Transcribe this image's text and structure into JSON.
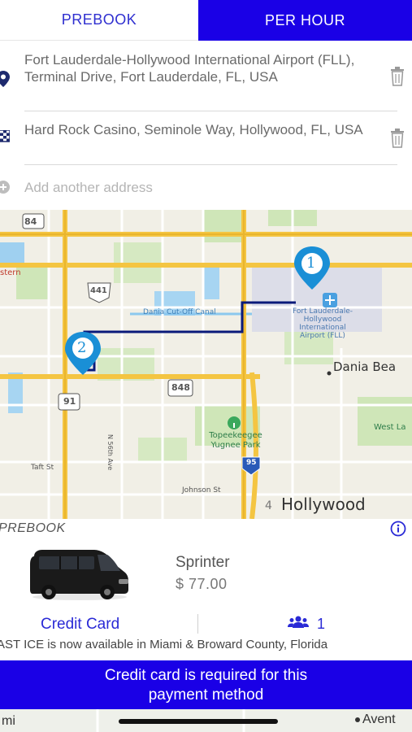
{
  "tabs": {
    "prebook": "PREBOOK",
    "per_hour": "PER HOUR"
  },
  "addresses": {
    "pickup": "Fort Lauderdale-Hollywood International Airport (FLL), Terminal Drive, Fort Lauderdale, FL, USA",
    "dropoff": "Hard Rock Casino, Seminole Way, Hollywood, FL, USA",
    "add_placeholder": "Add another address"
  },
  "map": {
    "marker_1": "1",
    "marker_2": "2",
    "labels": {
      "hwy_84": "84",
      "hwy_441": "441",
      "hwy_848": "848",
      "hwy_91": "91",
      "hwy_95": "95",
      "western": "stern",
      "canal": "Dania Cut-Off Canal",
      "airport": "Fort Lauderdale-Hollywood International Airport (FLL)",
      "dania": "Dania Bea",
      "west_la": "West La",
      "park": "Topeekeegee Yugnee Park",
      "taft": "Taft St",
      "johnson": "Johnson St",
      "hollywood": "Hollywood",
      "street_56": "N 56th Ave",
      "sheridan": "4"
    }
  },
  "card": {
    "title": "PREBOOK",
    "vehicle_name": "Sprinter",
    "price": "$ 77.00",
    "payment_method": "Credit Card",
    "passengers": "1",
    "notice": "AST ICE is now available in Miami & Broward County, Florida"
  },
  "banner": {
    "line1": "Credit card is required for this",
    "line2": "payment method"
  },
  "bottom_map": {
    "left": "mi",
    "right": "Avent"
  },
  "colors": {
    "accent": "#1a00e6",
    "marker": "#1a8fd6",
    "route": "#0a1a7a"
  }
}
